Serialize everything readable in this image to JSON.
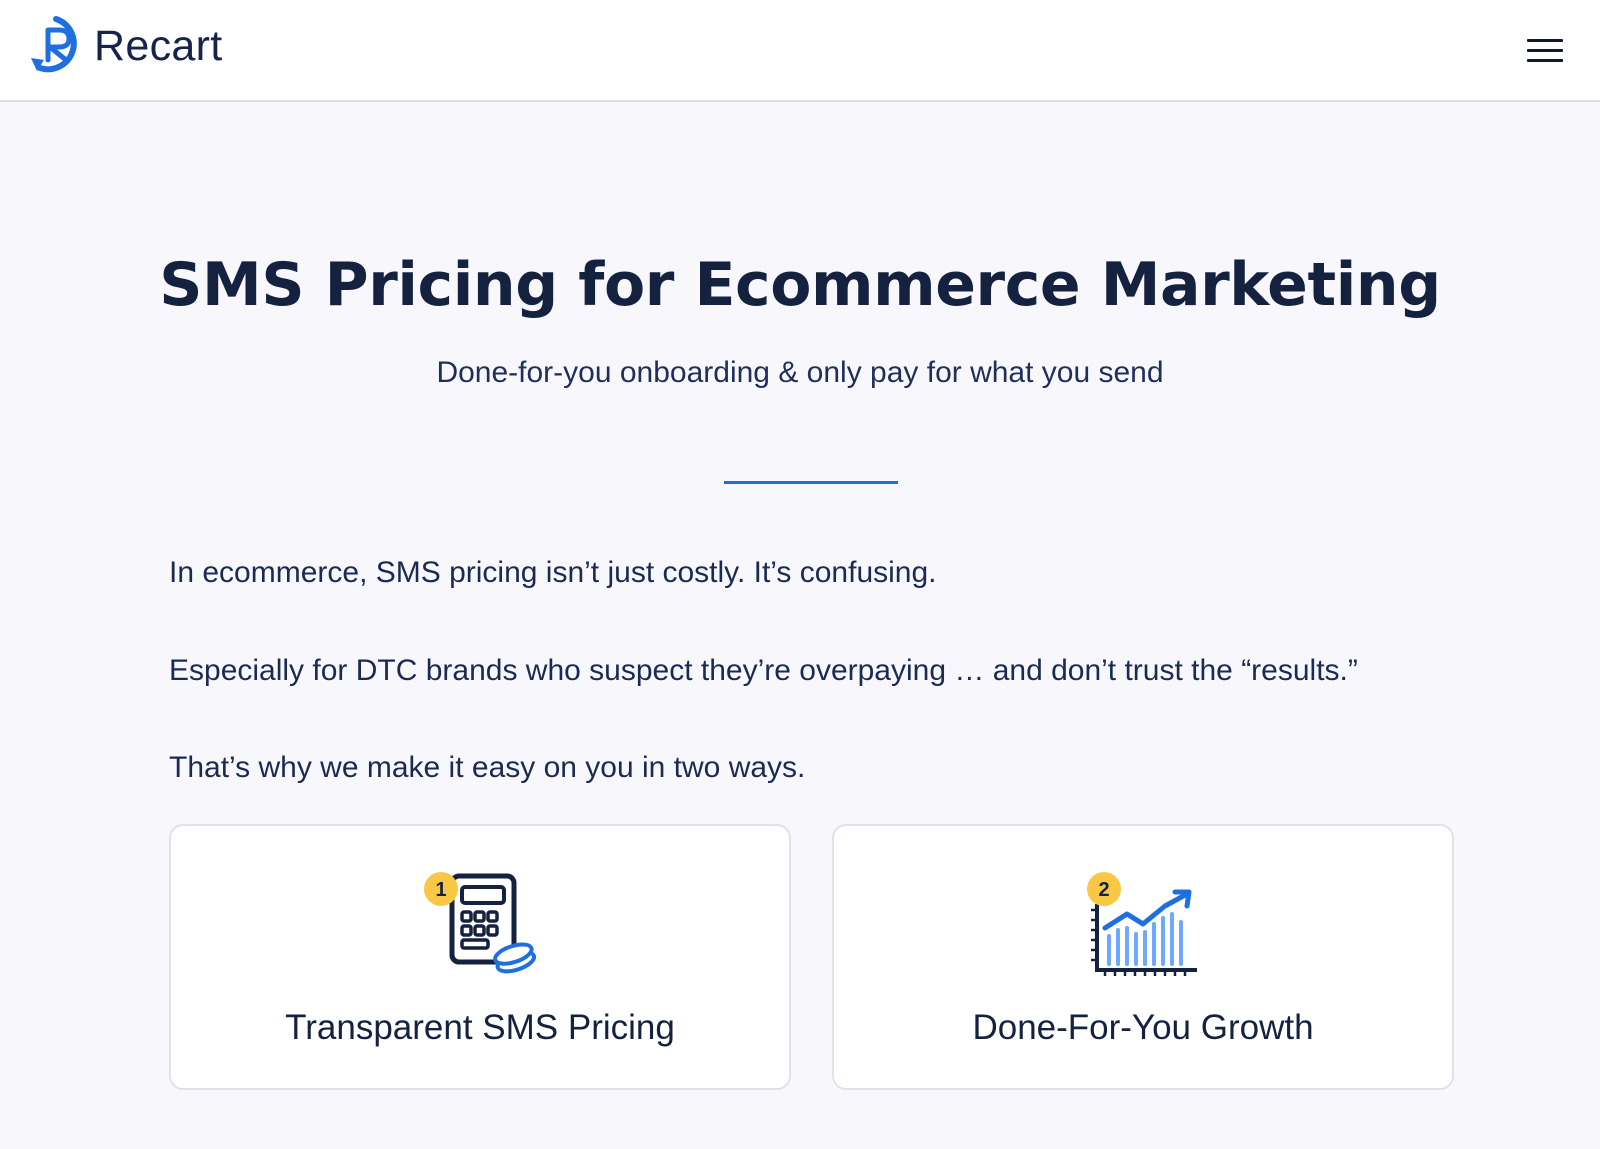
{
  "header": {
    "brand": "Recart",
    "menu_icon": "hamburger-menu-icon",
    "brand_color": "#1f6fe0"
  },
  "hero": {
    "title": "SMS Pricing for Ecommerce Marketing",
    "subtitle": "Done-for-you onboarding & only pay for what you send"
  },
  "intro": {
    "p1": "In ecommerce, SMS pricing isn’t just costly. It’s confusing.",
    "p2": "Especially for DTC brands who suspect they’re overpaying … and don’t trust the “results.”",
    "p3": "That’s why we make it easy on you in two ways."
  },
  "cards": [
    {
      "badge": "1",
      "icon": "calculator-coins-icon",
      "label": "Transparent SMS Pricing"
    },
    {
      "badge": "2",
      "icon": "growth-chart-icon",
      "label": "Done-For-You Growth"
    }
  ],
  "colors": {
    "accent": "#1f6fe0",
    "badge": "#f8c845",
    "heading": "#14213f"
  }
}
